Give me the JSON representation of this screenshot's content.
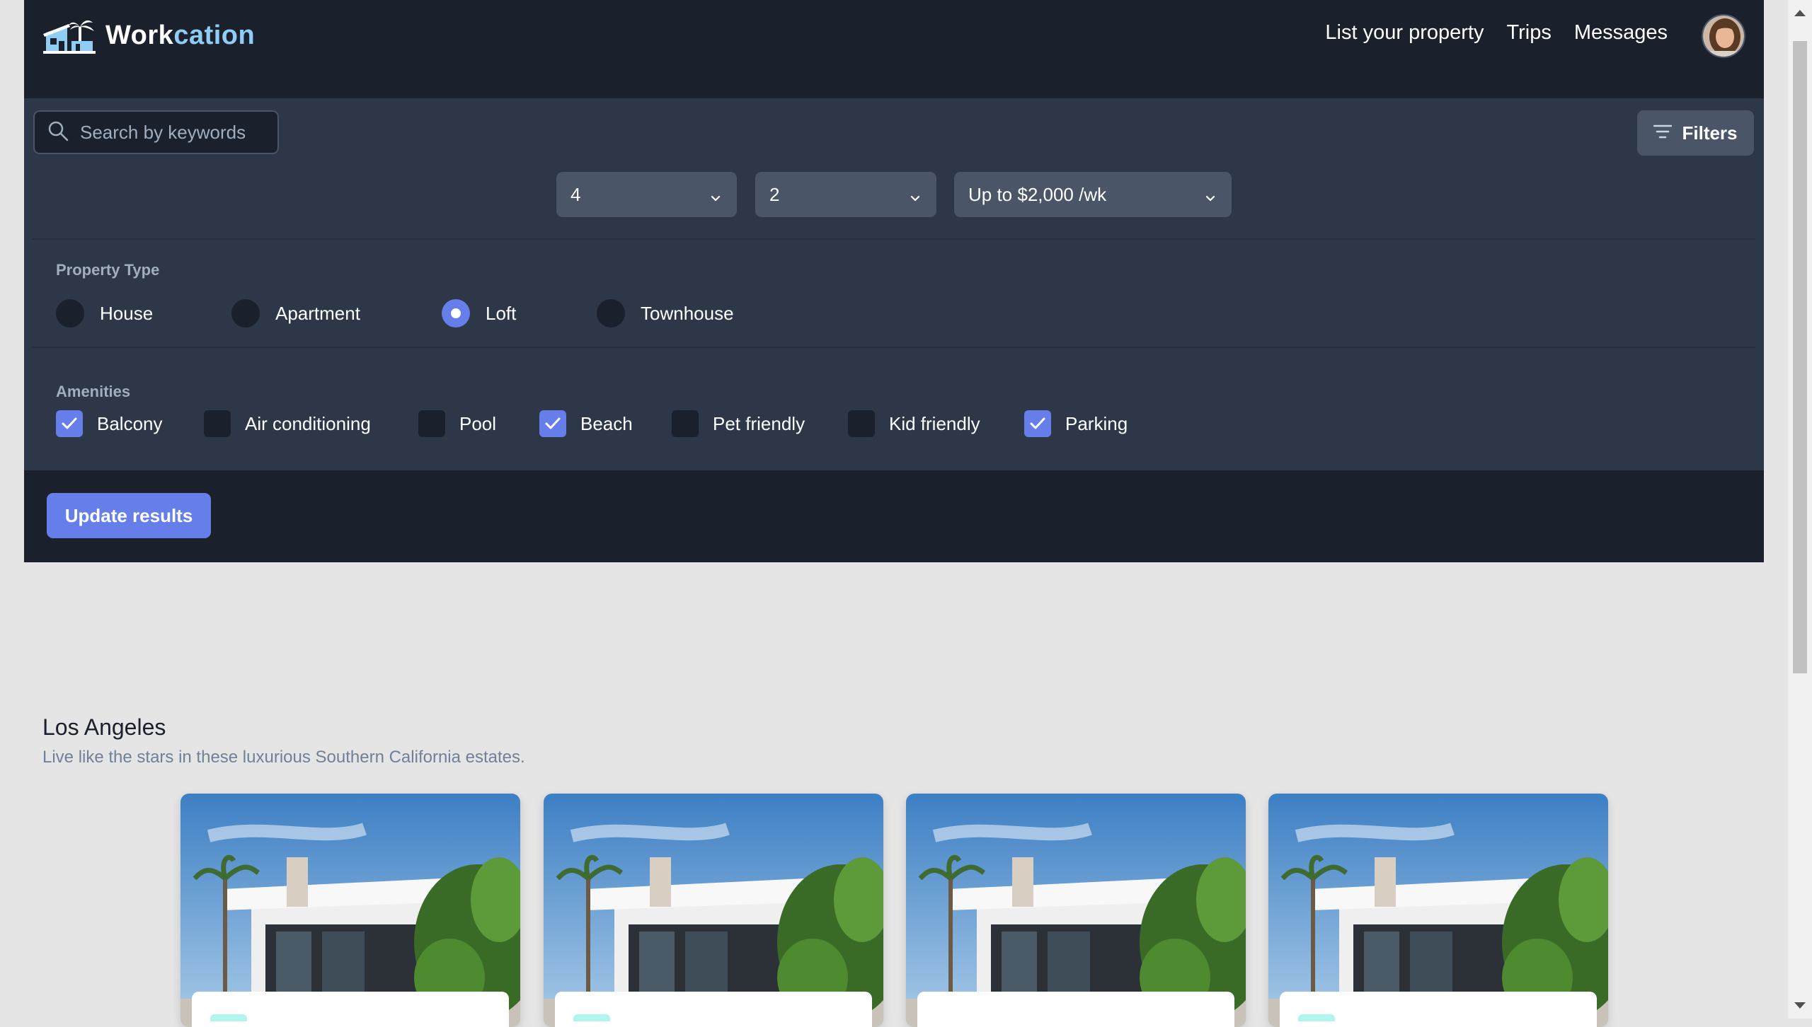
{
  "brand": {
    "part1": "Work",
    "part2": "cation",
    "logo_icon": "house-palm-logo-icon"
  },
  "nav": {
    "items": [
      "List your property",
      "Trips",
      "Messages"
    ],
    "avatar_icon": "user-avatar"
  },
  "search": {
    "placeholder": "Search by keywords",
    "value": "",
    "icon": "search-icon"
  },
  "filters_button": {
    "label": "Filters",
    "icon": "filter-lines-icon"
  },
  "selects": [
    {
      "value": "4",
      "icon": "chevron-down-icon"
    },
    {
      "value": "2",
      "icon": "chevron-down-icon"
    },
    {
      "value": "Up to $2,000 /wk",
      "icon": "chevron-down-icon"
    }
  ],
  "property_type": {
    "label": "Property Type",
    "options": [
      {
        "label": "House",
        "selected": false
      },
      {
        "label": "Apartment",
        "selected": false
      },
      {
        "label": "Loft",
        "selected": true
      },
      {
        "label": "Townhouse",
        "selected": false
      }
    ]
  },
  "amenities": {
    "label": "Amenities",
    "options": [
      {
        "label": "Balcony",
        "checked": true
      },
      {
        "label": "Air conditioning",
        "checked": false
      },
      {
        "label": "Pool",
        "checked": false
      },
      {
        "label": "Beach",
        "checked": true
      },
      {
        "label": "Pet friendly",
        "checked": false
      },
      {
        "label": "Kid friendly",
        "checked": false
      },
      {
        "label": "Parking",
        "checked": true
      }
    ]
  },
  "update_button": {
    "label": "Update results"
  },
  "location": {
    "title": "Los Angeles",
    "subtitle": "Live like the stars in these luxurious Southern California estates."
  },
  "colors": {
    "header_bg": "#1a202c",
    "panel_bg": "#2d3748",
    "accent": "#667eea",
    "page_bg": "#e5e5e5",
    "muted_text": "#718096"
  }
}
